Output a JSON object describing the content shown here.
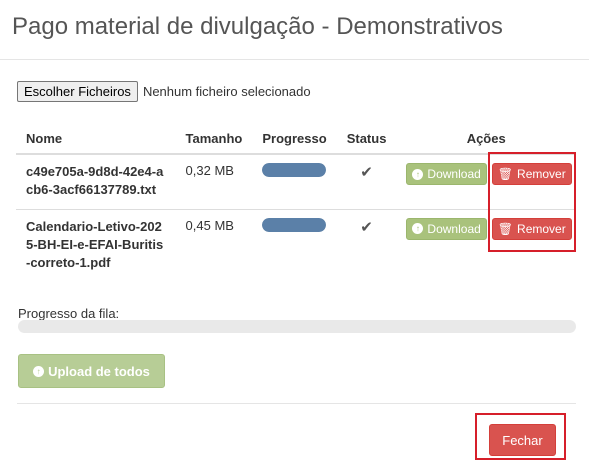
{
  "modal": {
    "title": "Pago material de divulgação - Demonstrativos"
  },
  "file_input": {
    "button_label": "Escolher Ficheiros",
    "status_text": "Nenhum ficheiro selecionado"
  },
  "table": {
    "headers": {
      "name": "Nome",
      "size": "Tamanho",
      "progress": "Progresso",
      "status": "Status",
      "actions": "Ações"
    },
    "rows": [
      {
        "name": "c49e705a-9d8d-42e4-acb6-3acf66137789.txt",
        "size": "0,32 MB",
        "progress": 1.0,
        "status_icon": "check-icon",
        "download_label": "Download",
        "remove_label": "Remover"
      },
      {
        "name": "Calendario-Letivo-2025-BH-EI-e-EFAI-Buritis-correto-1.pdf",
        "size": "0,45 MB",
        "progress": 1.0,
        "status_icon": "check-icon",
        "download_label": "Download",
        "remove_label": "Remover"
      }
    ]
  },
  "queue": {
    "label": "Progresso da fila:",
    "progress": 0
  },
  "upload_all": {
    "label": "Upload de todos"
  },
  "footer": {
    "close_label": "Fechar"
  },
  "colors": {
    "progress_fill": "#5b80a8",
    "download_button": "#a9c27c",
    "remove_button": "#d9534f",
    "highlight_border": "#d61f2a"
  }
}
